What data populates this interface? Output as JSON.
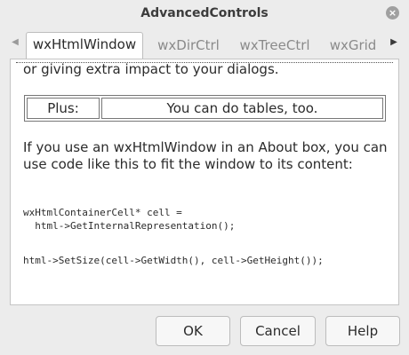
{
  "window": {
    "title": "AdvancedControls",
    "close_icon": "close-icon"
  },
  "tabs": {
    "prev_icon": "◀",
    "next_icon": "▶",
    "items": [
      {
        "label": "wxHtmlWindow",
        "active": true
      },
      {
        "label": "wxDirCtrl",
        "active": false
      },
      {
        "label": "wxTreeCtrl",
        "active": false
      },
      {
        "label": "wxGrid",
        "active": false
      }
    ]
  },
  "html": {
    "intro_text": "or giving extra impact to your dialogs.",
    "table": {
      "cell1": "Plus:",
      "cell2": "You can do tables, too."
    },
    "paragraph": "If you use an wxHtmlWindow in an About box, you can use code like this to fit the window to its content:",
    "code_block1": "wxHtmlContainerCell* cell =\n  html->GetInternalRepresentation();",
    "code_block2": "html->SetSize(cell->GetWidth(), cell->GetHeight());"
  },
  "buttons": {
    "ok": "OK",
    "cancel": "Cancel",
    "help": "Help"
  }
}
